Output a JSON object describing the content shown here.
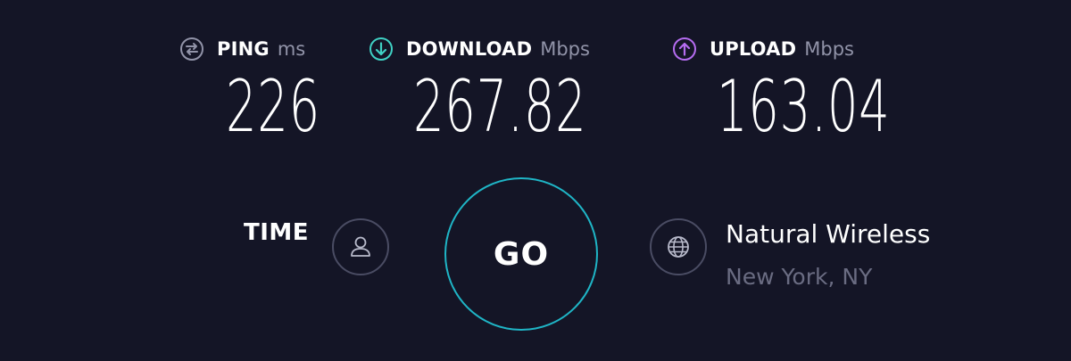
{
  "metrics": {
    "ping": {
      "label": "PING",
      "unit": "ms",
      "value": "226",
      "icon": "ping-icon",
      "color": "#9193a8"
    },
    "download": {
      "label": "DOWNLOAD",
      "unit": "Mbps",
      "value": "267.82",
      "icon": "download-arrow-icon",
      "color": "#3fd1c4"
    },
    "upload": {
      "label": "UPLOAD",
      "unit": "Mbps",
      "value": "163.04",
      "icon": "upload-arrow-icon",
      "color": "#b56cf0"
    }
  },
  "time": {
    "label": "TIME",
    "icon": "user-icon"
  },
  "go_button": {
    "label": "GO",
    "ring_color": "#1fb5c6"
  },
  "provider": {
    "name": "Natural Wireless",
    "location": "New York, NY",
    "icon": "globe-icon"
  },
  "colors": {
    "background": "#141526",
    "muted_text": "#9193a8",
    "circle_border": "#4a4c63"
  }
}
